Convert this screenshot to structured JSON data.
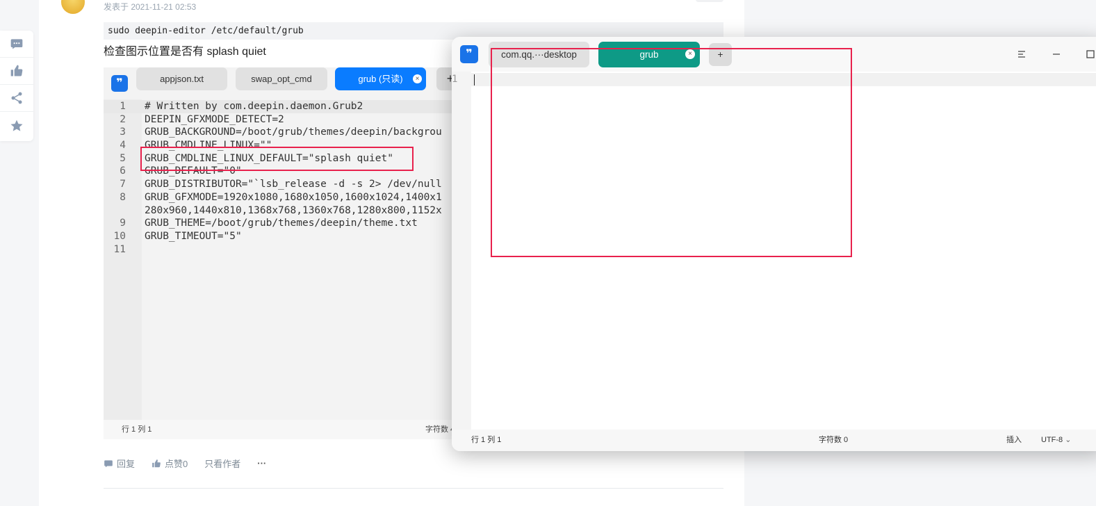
{
  "post": {
    "time": "发表于 2021-11-21 02:53",
    "command": "sudo deepin-editor /etc/default/grub",
    "instruction": "检查图示位置是否有 splash quiet",
    "actions": {
      "reply": "回复",
      "like": "点赞0",
      "author_only": "只看作者",
      "more": "···"
    }
  },
  "embedded_editor": {
    "tabs": [
      "appjson.txt",
      "swap_opt_cmd",
      "grub (只读)"
    ],
    "active_tab": "grub (只读)",
    "code": [
      {
        "n": "1",
        "t": "# Written by com.deepin.daemon.Grub2"
      },
      {
        "n": "2",
        "t": "DEEPIN_GFXMODE_DETECT=2"
      },
      {
        "n": "3",
        "t": "GRUB_BACKGROUND=/boot/grub/themes/deepin/backgrou"
      },
      {
        "n": "4",
        "t": "GRUB_CMDLINE_LINUX=\"\""
      },
      {
        "n": "5",
        "t": "GRUB_CMDLINE_LINUX_DEFAULT=\"splash quiet\""
      },
      {
        "n": "6",
        "t": "GRUB_DEFAULT=\"0\""
      },
      {
        "n": "7",
        "t": "GRUB_DISTRIBUTOR=\"`lsb_release -d -s 2> /dev/null"
      },
      {
        "n": "8",
        "t": "GRUB_GFXMODE=1920x1080,1680x1050,1600x1024,1400x1"
      },
      {
        "n": "",
        "t": "280x960,1440x810,1368x768,1360x768,1280x800,1152x"
      },
      {
        "n": "9",
        "t": "GRUB_THEME=/boot/grub/themes/deepin/theme.txt"
      },
      {
        "n": "10",
        "t": "GRUB_TIMEOUT=\"5\""
      },
      {
        "n": "11",
        "t": ""
      }
    ],
    "status_position": "行 1  列 1",
    "status_chars": "字符数 4"
  },
  "editor_window": {
    "tabs": [
      "com.qq.···desktop",
      "grub"
    ],
    "active_tab": "grub",
    "add_tab": "+",
    "line_number": "1",
    "status_position": "行 1  列 1",
    "status_chars": "字符数 0",
    "status_mode": "插入",
    "status_encoding": "UTF-8"
  },
  "icons": [
    "comment-icon",
    "thumbs-up-icon",
    "share-icon",
    "star-icon",
    "menu-icon",
    "minimize-icon",
    "maximize-icon"
  ],
  "colors": {
    "highlight": "#e8214c",
    "active_tab_blue": "#0a7cff",
    "active_tab_teal": "#0e9a86"
  }
}
